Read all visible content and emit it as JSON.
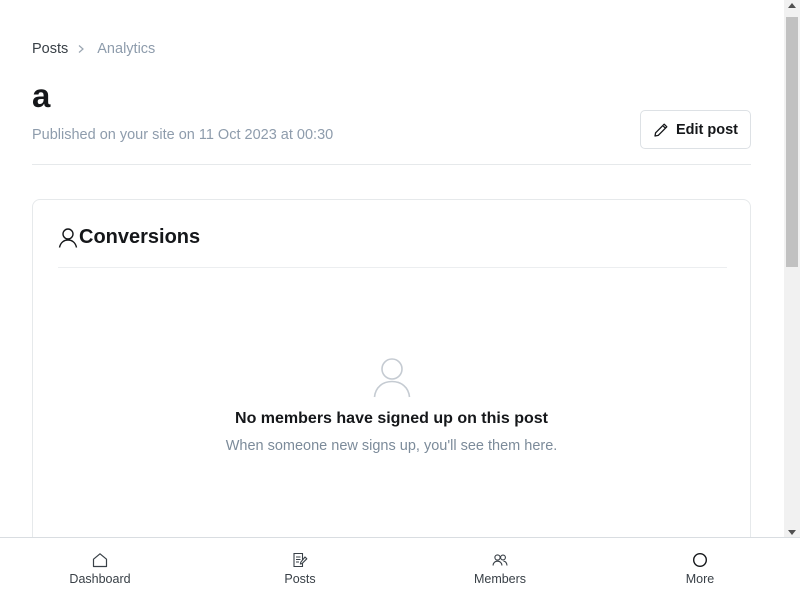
{
  "breadcrumb": {
    "parent": "Posts",
    "current": "Analytics"
  },
  "post": {
    "title": "a",
    "published": "Published on your site on 11 Oct 2023 at 00:30",
    "edit_label": "Edit post"
  },
  "conversions": {
    "title": "Conversions",
    "empty_title": "No members have signed up on this post",
    "empty_subtitle": "When someone new signs up, you'll see them here."
  },
  "bottom_nav": {
    "items": [
      {
        "label": "Dashboard",
        "icon": "home-icon"
      },
      {
        "label": "Posts",
        "icon": "posts-icon"
      },
      {
        "label": "Members",
        "icon": "members-icon"
      },
      {
        "label": "More",
        "icon": "more-icon"
      }
    ]
  },
  "colors": {
    "text": "#15171a",
    "muted": "#8e9cac",
    "border": "#e6e9eb"
  }
}
